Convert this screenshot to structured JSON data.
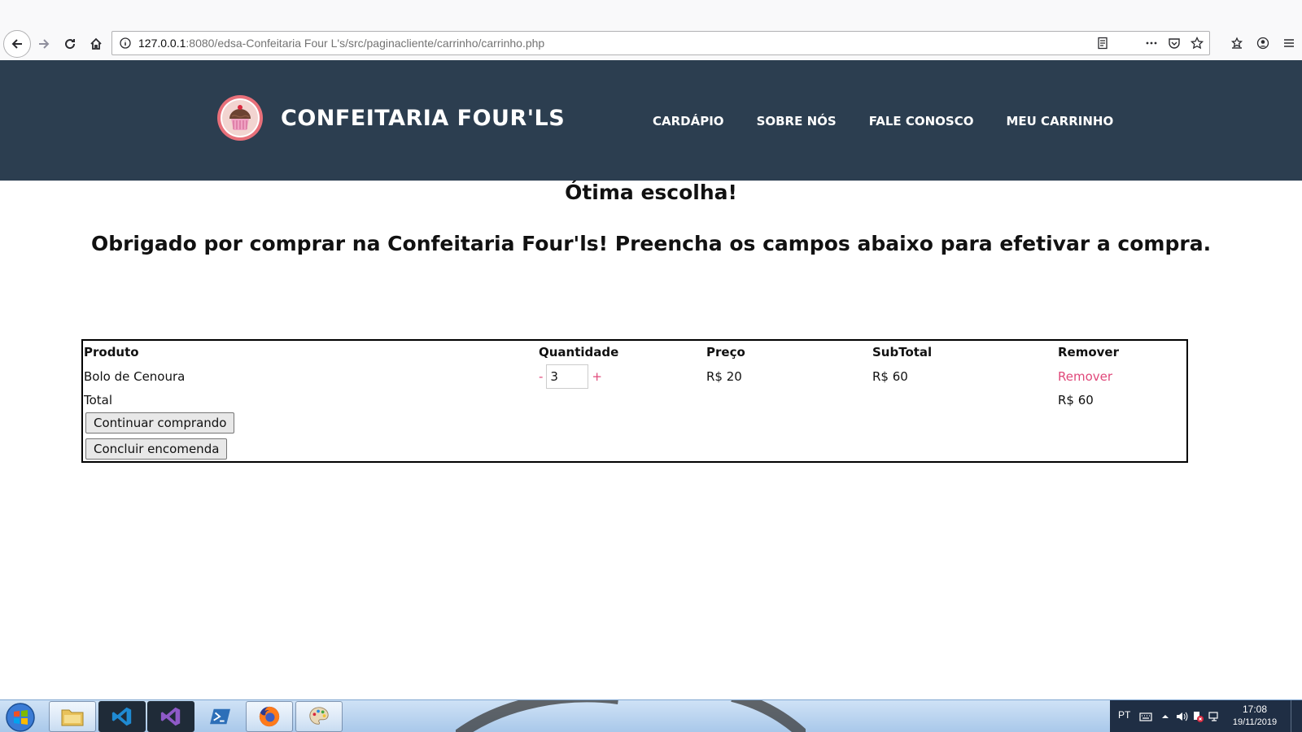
{
  "browser": {
    "url_host": "127.0.0.1",
    "url_path": ":8080/edsa-Confeitaria Four L's/src/paginacliente/carrinho/carrinho.php"
  },
  "site": {
    "title": "CONFEITARIA FOUR'LS",
    "nav": [
      {
        "label": "CARDÁPIO"
      },
      {
        "label": "SOBRE NÓS"
      },
      {
        "label": "FALE CONOSCO"
      },
      {
        "label": "MEU CARRINHO"
      }
    ]
  },
  "main": {
    "heading": "Ótima escolha!",
    "subheading": "Obrigado por comprar na Confeitaria Four'ls! Preencha os campos abaixo para efetivar a compra."
  },
  "cart": {
    "headers": {
      "product": "Produto",
      "quantity": "Quantidade",
      "price": "Preço",
      "subtotal": "SubTotal",
      "remove": "Remover"
    },
    "items": [
      {
        "product": "Bolo de Cenoura",
        "minus": "-",
        "quantity": "3",
        "plus": "+",
        "price": "R$ 20",
        "subtotal": "R$ 60",
        "remove": "Remover"
      }
    ],
    "total_label": "Total",
    "total_value": "R$ 60",
    "continue_button": "Continuar comprando",
    "finish_button": "Concluir encomenda"
  },
  "taskbar": {
    "language": "PT",
    "time": "17:08",
    "date": "19/11/2019"
  },
  "colors": {
    "header_bg": "#2c3e50",
    "link_accent": "#e0487a",
    "logo_ring": "#e8707a"
  }
}
